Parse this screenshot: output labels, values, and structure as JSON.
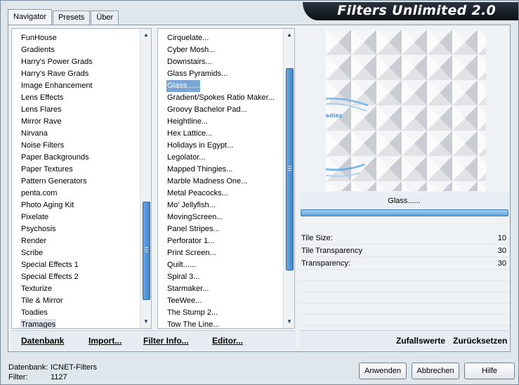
{
  "tabs": [
    {
      "label": "Navigator"
    },
    {
      "label": "Presets"
    },
    {
      "label": "Über"
    }
  ],
  "title": "Filters Unlimited 2.0",
  "categories": [
    "FunHouse",
    "Gradients",
    "Harry's Power Grads",
    "Harry's Rave Grads",
    "Image Enhancement",
    "Lens Effects",
    "Lens Flares",
    "Mirror Rave",
    "Nirvana",
    "Noise Filters",
    "Paper Backgrounds",
    "Paper Textures",
    "Pattern Generators",
    "penta.com",
    "Photo Aging Kit",
    "Pixelate",
    "Psychosis",
    "Render",
    "Scribe",
    "Special Effects 1",
    "Special Effects 2",
    "Texturize",
    "Tile & Mirror",
    "Toadies",
    "Tramages"
  ],
  "filters": [
    "Cirquelate...",
    "Cyber Mosh...",
    "Downstairs...",
    "Glass Pyramids...",
    "Glass......",
    "Gradient/Spokes Ratio Maker...",
    "Groovy Bachelor Pad...",
    "Heightline...",
    "Hex Lattice...",
    "Holidays in Egypt...",
    "Legolator...",
    "Mapped Thingies...",
    "Marble Madness One...",
    "Metal Peacocks...",
    "Mo' Jellyfish...",
    "MovingScreen...",
    "Panel Stripes...",
    "Perforator 1...",
    "Print Screen...",
    "Quilt......",
    "Spiral 3...",
    "Starmaker...",
    "TeeWee...",
    "The Stump 2...",
    "Tow The Line..."
  ],
  "left_buttons": {
    "database": "Datenbank",
    "import": "Import...",
    "filter_info": "Filter Info...",
    "editor": "Editor..."
  },
  "right_buttons": {
    "random": "Zufallswerte",
    "reset": "Zurücksetzen"
  },
  "selected_filter": "Glass......",
  "params": [
    {
      "label": "Tile Size:",
      "value": "10"
    },
    {
      "label": "Tile Transparency",
      "value": "30"
    },
    {
      "label": "Transparency:",
      "value": "30"
    }
  ],
  "status": {
    "db_label": "Datenbank:",
    "db_value": "ICNET-Filters",
    "filter_label": "Filter:",
    "filter_value": "1127"
  },
  "dialog_buttons": {
    "apply": "Anwenden",
    "cancel": "Abbrechen",
    "help": "Hilfe"
  },
  "watermark": "©Bastelparadies",
  "colors": {
    "selection": "#7aa6d6",
    "scroll_thumb": "#4a90d2",
    "title_bar": "#131a22"
  }
}
